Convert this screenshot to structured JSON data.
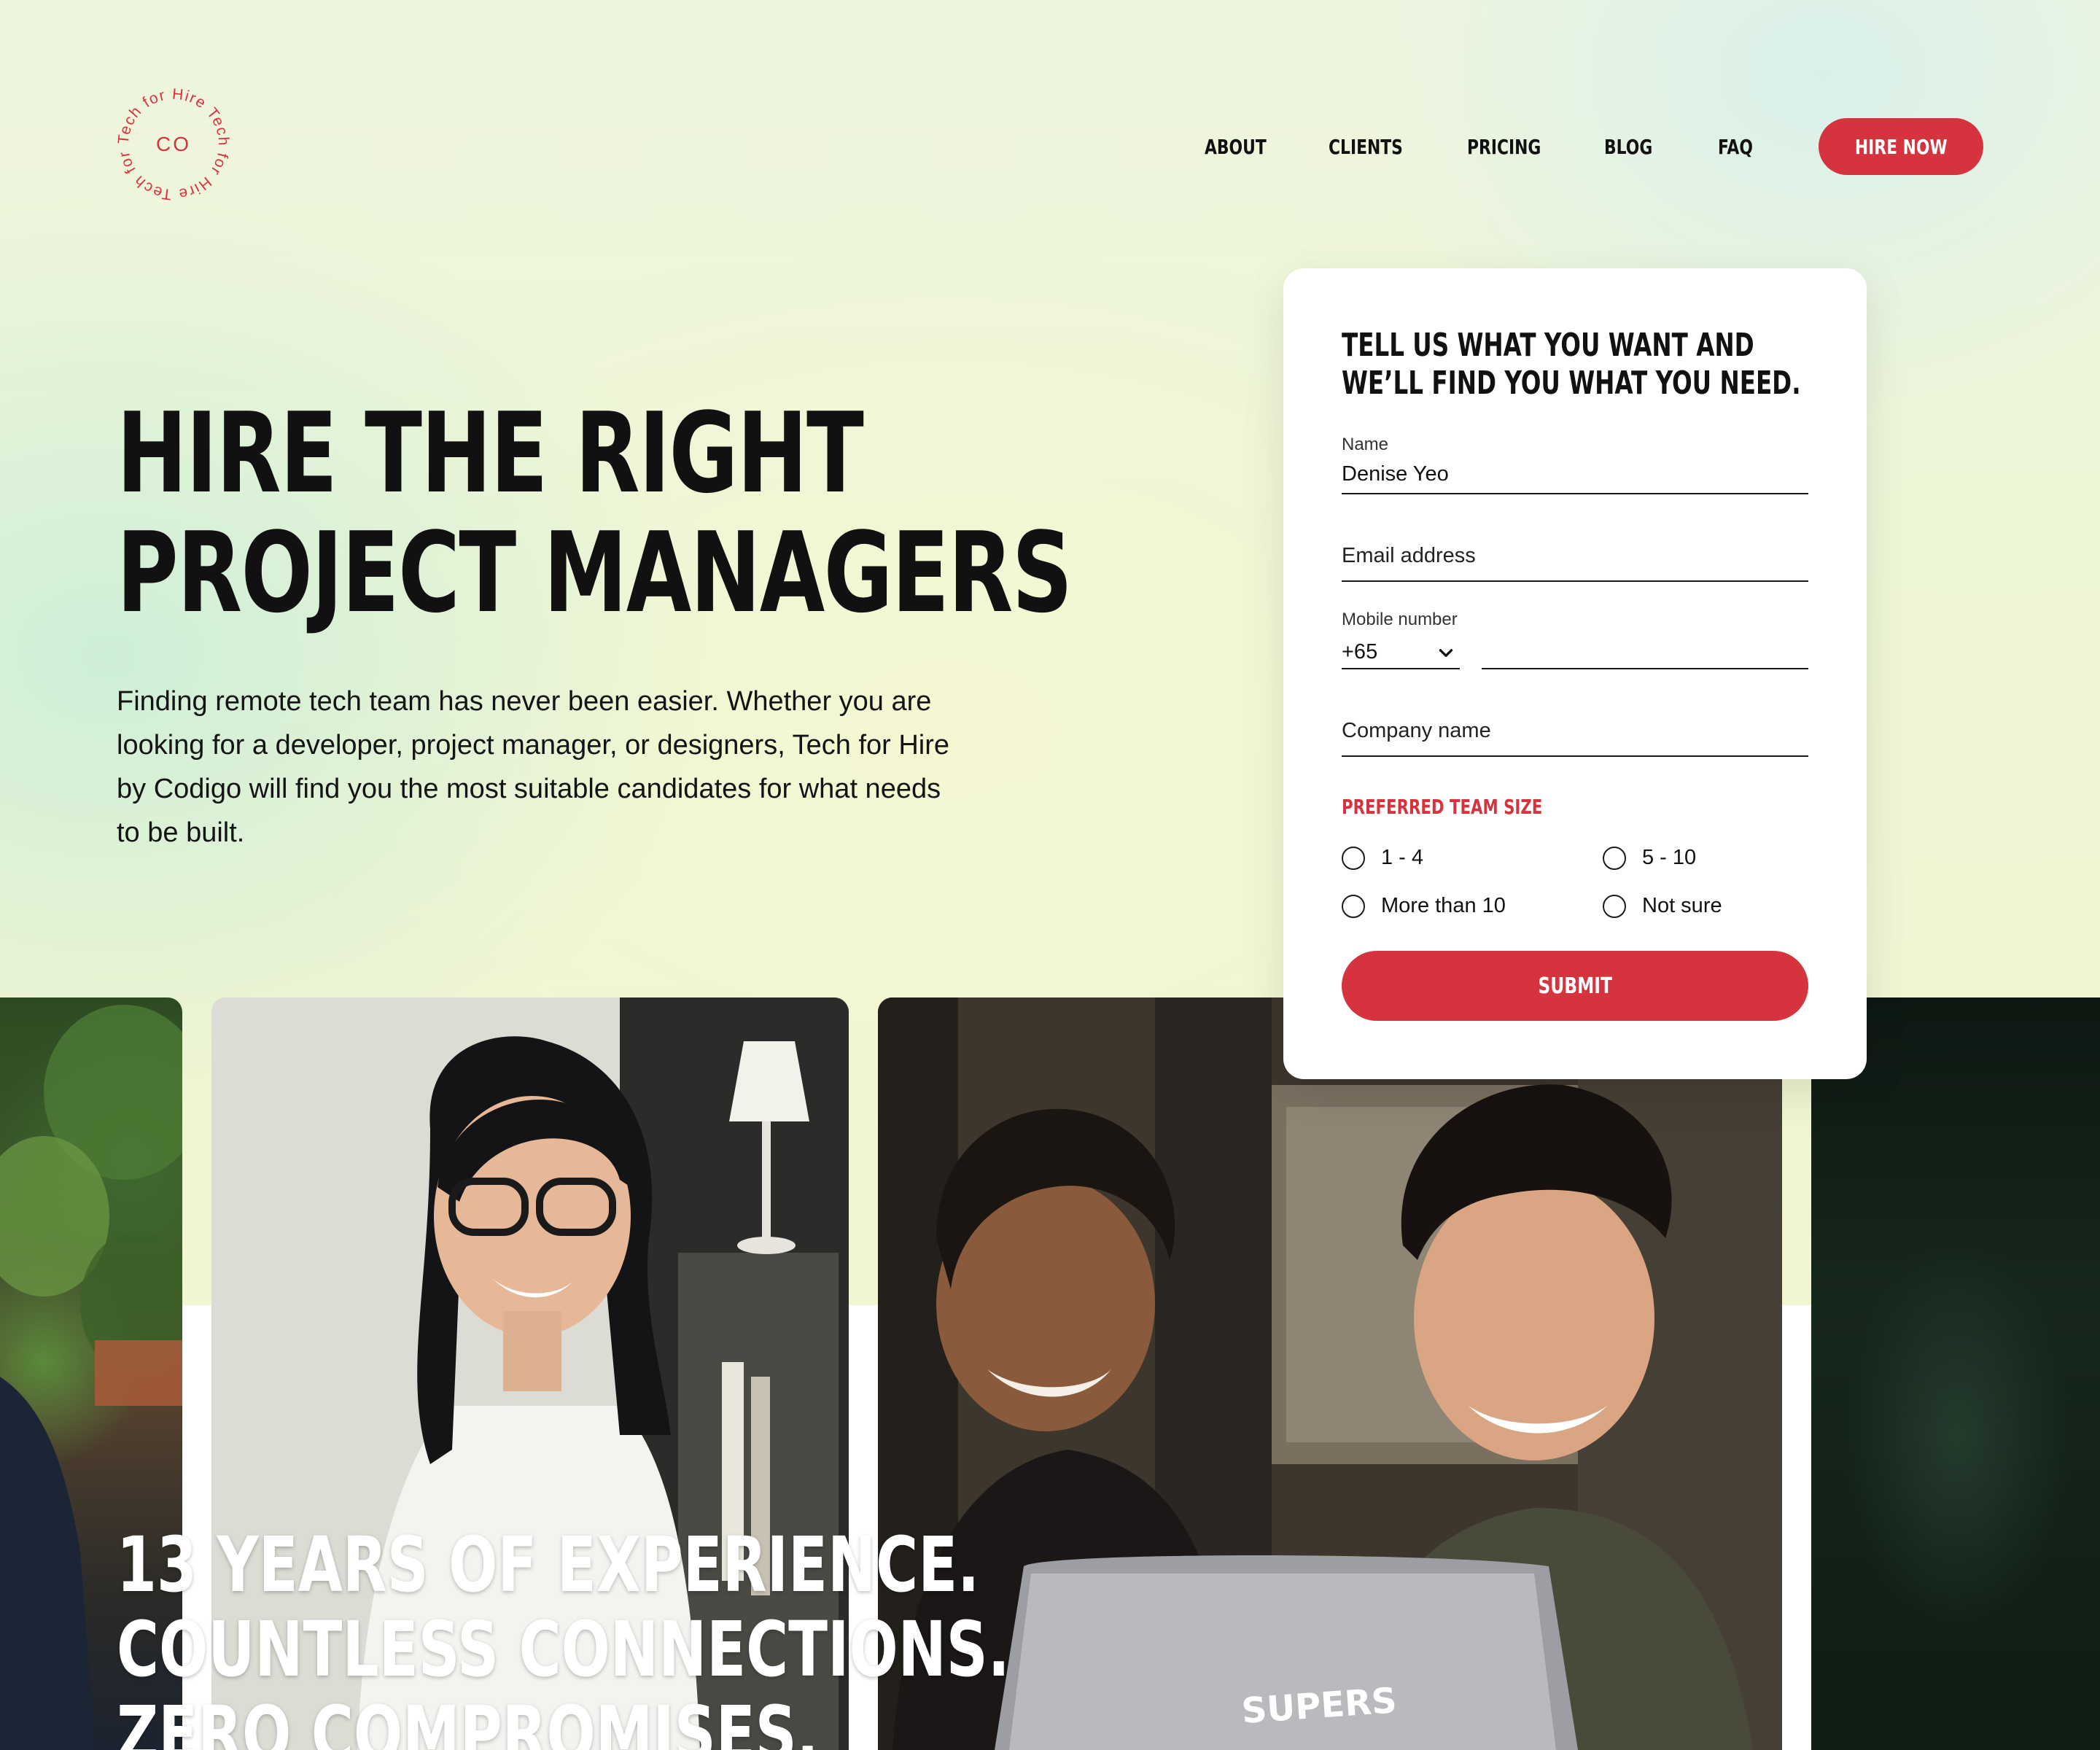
{
  "brand": {
    "logo_letters": "CO",
    "logo_ring_text": "Tech for Hire Tech for Hire Tech for Hire ",
    "accent": "#d5343f"
  },
  "nav": {
    "items": [
      {
        "label": "ABOUT"
      },
      {
        "label": "CLIENTS"
      },
      {
        "label": "PRICING"
      },
      {
        "label": "BLOG"
      },
      {
        "label": "FAQ"
      }
    ],
    "cta": "HIRE NOW"
  },
  "hero": {
    "headline_line1": "HIRE THE RIGHT",
    "headline_line2": "PROJECT MANAGERS",
    "intro": "Finding remote tech team has never been easier. Whether you are looking for a developer, project manager, or designers, Tech for Hire by Codigo will find you the most suitable candidates for what needs to be built."
  },
  "form": {
    "title_line1": "TELL US WHAT YOU WANT AND",
    "title_line2": "WE’LL FIND YOU WHAT YOU NEED.",
    "name_label": "Name",
    "name_value": "Denise Yeo",
    "email_placeholder": "Email address",
    "mobile_label": "Mobile number",
    "mobile_code": "+65",
    "company_placeholder": "Company name",
    "team_size_title": "PREFERRED TEAM SIZE",
    "team_options": [
      "1 - 4",
      "5 - 10",
      "More than 10",
      "Not sure"
    ],
    "submit": "SUBMIT"
  },
  "stats": {
    "line1": "13 YEARS OF EXPERIENCE.",
    "line2": "COUNTLESS CONNECTIONS.",
    "line3": "ZERO COMPROMISES."
  }
}
